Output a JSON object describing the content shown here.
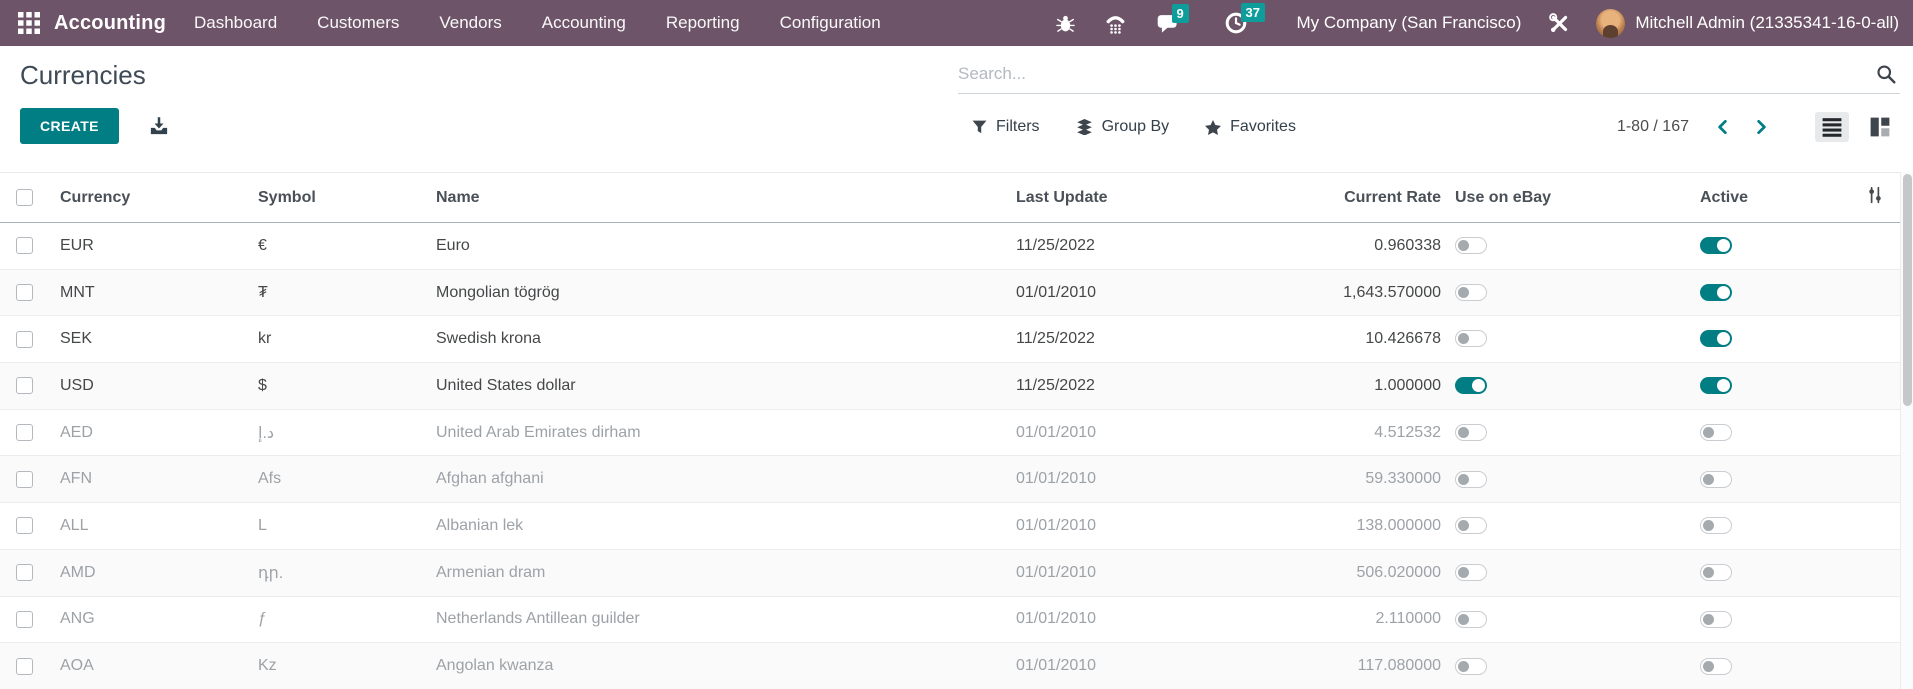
{
  "topbar": {
    "app_name": "Accounting",
    "menu_items": [
      "Dashboard",
      "Customers",
      "Vendors",
      "Accounting",
      "Reporting",
      "Configuration"
    ],
    "messages_badge": "9",
    "activities_badge": "37",
    "company": "My Company (San Francisco)",
    "user": "Mitchell Admin (21335341-16-0-all)"
  },
  "control_panel": {
    "title": "Currencies",
    "create_label": "CREATE",
    "search_placeholder": "Search...",
    "filters_label": "Filters",
    "group_by_label": "Group By",
    "favorites_label": "Favorites",
    "pager": "1-80 / 167"
  },
  "table": {
    "columns": [
      "Currency",
      "Symbol",
      "Name",
      "Last Update",
      "Current Rate",
      "Use on eBay",
      "Active"
    ],
    "rows": [
      {
        "currency": "EUR",
        "symbol": "€",
        "name": "Euro",
        "last_update": "11/25/2022",
        "rate": "0.960338",
        "ebay": false,
        "active": true
      },
      {
        "currency": "MNT",
        "symbol": "₮",
        "name": "Mongolian tögrög",
        "last_update": "01/01/2010",
        "rate": "1,643.570000",
        "ebay": false,
        "active": true
      },
      {
        "currency": "SEK",
        "symbol": "kr",
        "name": "Swedish krona",
        "last_update": "11/25/2022",
        "rate": "10.426678",
        "ebay": false,
        "active": true
      },
      {
        "currency": "USD",
        "symbol": "$",
        "name": "United States dollar",
        "last_update": "11/25/2022",
        "rate": "1.000000",
        "ebay": true,
        "active": true
      },
      {
        "currency": "AED",
        "symbol": "د.إ",
        "name": "United Arab Emirates dirham",
        "last_update": "01/01/2010",
        "rate": "4.512532",
        "ebay": false,
        "active": false
      },
      {
        "currency": "AFN",
        "symbol": "Afs",
        "name": "Afghan afghani",
        "last_update": "01/01/2010",
        "rate": "59.330000",
        "ebay": false,
        "active": false
      },
      {
        "currency": "ALL",
        "symbol": "L",
        "name": "Albanian lek",
        "last_update": "01/01/2010",
        "rate": "138.000000",
        "ebay": false,
        "active": false
      },
      {
        "currency": "AMD",
        "symbol": "դր.",
        "name": "Armenian dram",
        "last_update": "01/01/2010",
        "rate": "506.020000",
        "ebay": false,
        "active": false
      },
      {
        "currency": "ANG",
        "symbol": "ƒ",
        "name": "Netherlands Antillean guilder",
        "last_update": "01/01/2010",
        "rate": "2.110000",
        "ebay": false,
        "active": false
      },
      {
        "currency": "AOA",
        "symbol": "Kz",
        "name": "Angolan kwanza",
        "last_update": "01/01/2010",
        "rate": "117.080000",
        "ebay": false,
        "active": false
      }
    ]
  },
  "icons": {
    "apps_grid": "grid-3x3",
    "bug": "bug",
    "phone": "phone-keypad",
    "chat": "speech-bubble",
    "clock": "clock",
    "tools": "wrench-screwdriver",
    "search": "magnifier",
    "download": "arrow-into-tray",
    "filters": "funnel",
    "group_by": "layers",
    "favorites": "star",
    "pager_prev": "chevron-left",
    "pager_next": "chevron-right",
    "list_view": "list-bars",
    "kanban_view": "kanban-blocks",
    "table_settings": "sliders"
  },
  "colors": {
    "topbar_bg": "#6d5468",
    "accent_teal": "#017e84",
    "badge_teal": "#0e9d9a",
    "header_text": "#495057",
    "muted_text": "#9da2a7"
  }
}
